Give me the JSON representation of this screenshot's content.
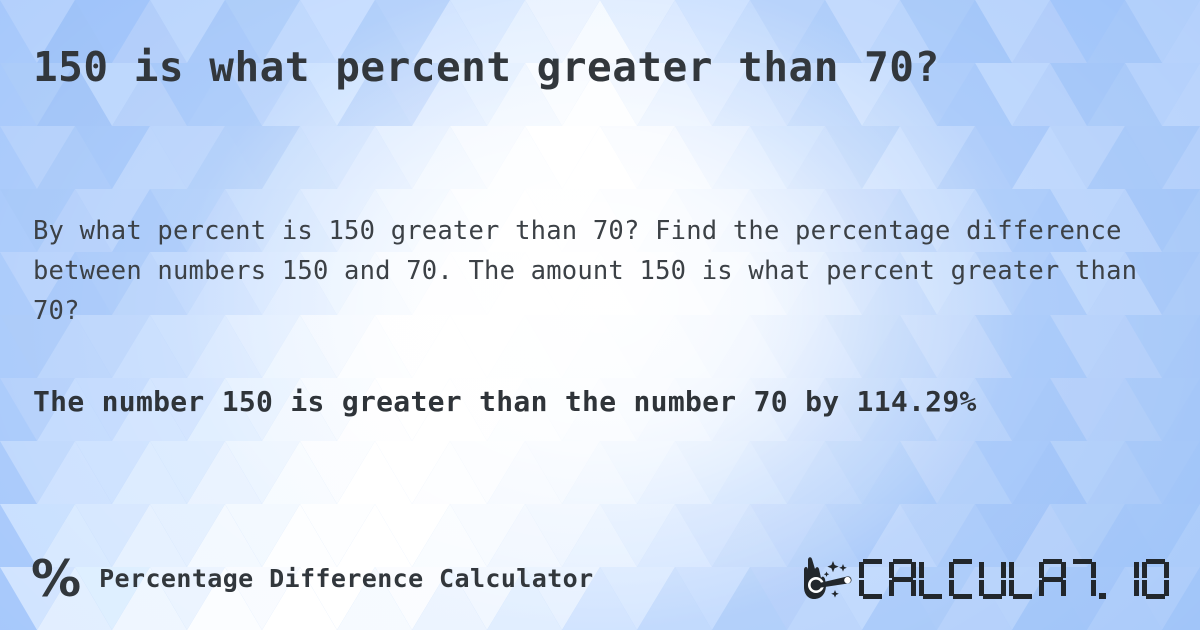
{
  "page": {
    "title": "150 is what percent greater than 70?",
    "description": "By what percent is 150 greater than 70? Find the percentage difference between numbers 150 and 70. The amount 150 is what percent greater than 70?",
    "answer": "The number 150 is greater than the number 70 by 114.29%",
    "result_value": "114.29%",
    "numbers": {
      "first": "150",
      "second": "70"
    }
  },
  "footer": {
    "percent_symbol": "%",
    "label": "Percentage Difference Calculator",
    "brand": {
      "name": "CALCULAT.IO",
      "letters": [
        "C",
        "A",
        "L",
        "C",
        "U",
        "L",
        "A",
        "T",
        ".",
        "I",
        "O"
      ]
    }
  },
  "theme": {
    "background_base": "#a6c8fb",
    "background_highlight": "#f7fafe",
    "text_color": "#32373c",
    "description_color": "#3c4146",
    "logo_color": "#22272c"
  }
}
